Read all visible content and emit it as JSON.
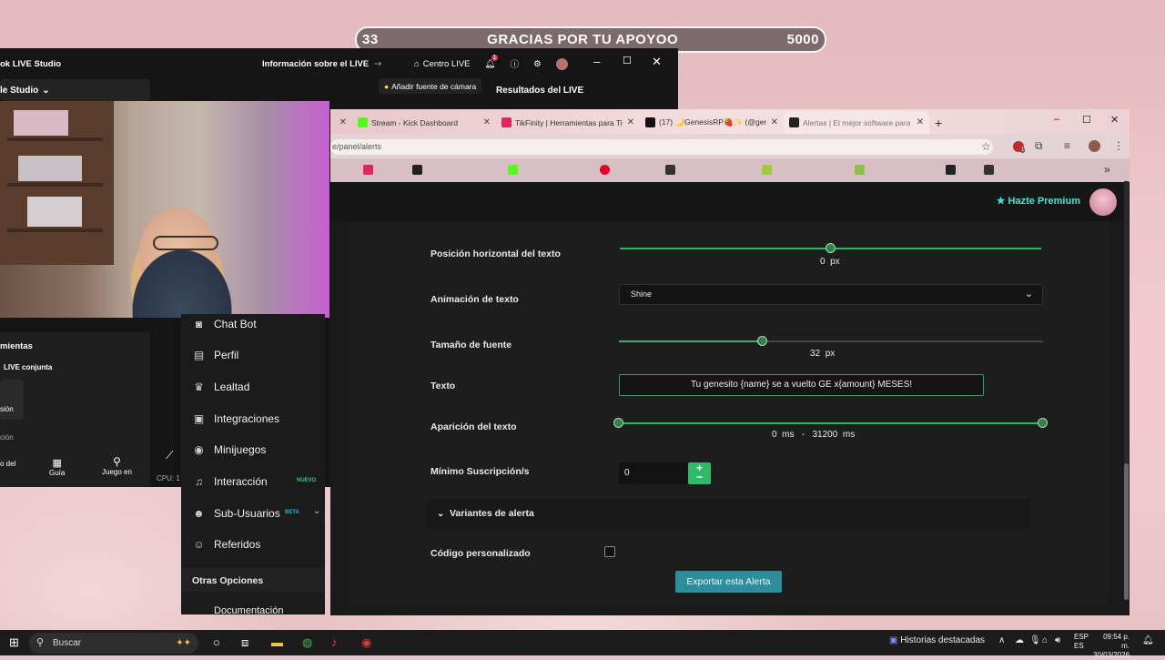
{
  "overlay": {
    "left_count": "33",
    "message": "GRACIAS POR TU APOYOO",
    "right_count": "5000"
  },
  "studio": {
    "title": "ok LIVE Studio",
    "scene_selector": "le Studio",
    "info_link": "Información sobre el LIVE",
    "center_live": "Centro LIVE",
    "notif_count": "1",
    "add_camera": "Añadir fuente de cámara",
    "results": "Resultados del LIVE",
    "tools_header": "mientas",
    "joint_live": "LIVE conjunta",
    "session_label": "sión",
    "action_label": "ción",
    "tool_left": "o del",
    "tool_guide": "Guía",
    "tool_game": "Juego en",
    "cpu": "CPU: 1"
  },
  "sidebar": {
    "items": [
      {
        "label": "Chat Bot",
        "icon": "robot-icon"
      },
      {
        "label": "Perfil",
        "icon": "id-card-icon"
      },
      {
        "label": "Lealtad",
        "icon": "trophy-icon"
      },
      {
        "label": "Integraciones",
        "icon": "plug-icon"
      },
      {
        "label": "Minijuegos",
        "icon": "gamepad-icon"
      },
      {
        "label": "Interacción",
        "icon": "music-icon",
        "badge": "NUEVO"
      },
      {
        "label": "Sub-Usuarios",
        "icon": "users-icon",
        "badge": "BETA"
      },
      {
        "label": "Referidos",
        "icon": "user-friends-icon"
      }
    ],
    "other_header": "Otras Opciones",
    "doc": "Documentación"
  },
  "browser": {
    "tabs": [
      {
        "title": "Stream - Kick Dashboard",
        "color": "#53fc18"
      },
      {
        "title": "TikFinity | Herramientas para Ti",
        "color": "#e0245e"
      },
      {
        "title": "(17) 🌙GenesisRP🍓✨ (@gen",
        "color": "#111111"
      },
      {
        "title": "Alertas | El mejor software para",
        "color": "#222222"
      }
    ],
    "url": "e/panel/alerts",
    "profile_badge": "1"
  },
  "page": {
    "premium": "Hazte Premium",
    "fields": {
      "h_pos_label": "Posición horizontal del texto",
      "h_pos_value": "0",
      "h_pos_unit": "px",
      "anim_label": "Animación de texto",
      "anim_value": "Shine",
      "font_label": "Tamaño de fuente",
      "font_value": "32",
      "font_unit": "px",
      "text_label": "Texto",
      "text_value": "Tu genesito {name} se a vuelto GE x{amount} MESES!",
      "appear_label": "Aparición del texto",
      "appear_start": "0",
      "appear_sep": "-",
      "appear_end": "31200",
      "appear_unit": "ms",
      "min_sub_label": "Mínimo Suscripción/s",
      "min_sub_value": "0",
      "variants_label": "Variantes de alerta",
      "custom_code_label": "Código personalizado",
      "export_button": "Exportar esta Alerta"
    },
    "slider_levels": {
      "h_pos": 0.5,
      "font": 0.34,
      "appear_start": 0.0,
      "appear_end": 1.0
    }
  },
  "taskbar": {
    "search": "Buscar",
    "news": "Historias destacadas",
    "lang1": "ESP",
    "lang2": "ES",
    "time": "09:54 p. m.",
    "date": "30/03/2026"
  }
}
